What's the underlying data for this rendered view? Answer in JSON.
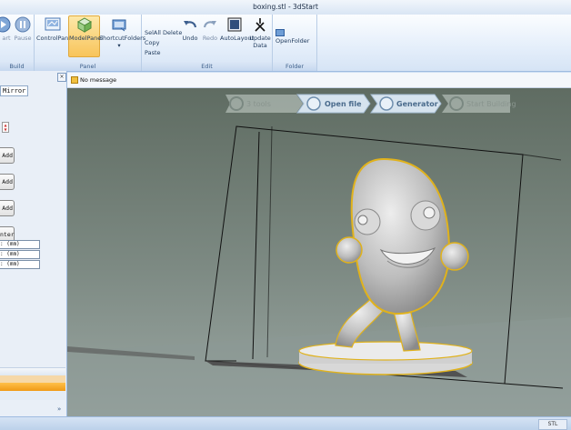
{
  "window": {
    "title": "boxing.stl - 3dStart"
  },
  "ribbon": {
    "build": {
      "label": "Build",
      "start": "art",
      "pause": "Pause"
    },
    "panel": {
      "label": "Panel",
      "control_panel": "ControlPanel",
      "model_panel": "ModelPanel",
      "shortcut_folders": "ShortcutFolders"
    },
    "edit": {
      "label": "Edit",
      "select_all": "SelAll",
      "delete": "Delete",
      "copy": "Copy",
      "paste": "Paste",
      "undo": "Undo",
      "redo": "Redo",
      "autolayout": "AutoLayout",
      "update_data_line1": "Update",
      "update_data_line2": "Data"
    },
    "folder": {
      "label": "Folder",
      "open_folder": "OpenFolder"
    }
  },
  "left_panel": {
    "tab_mirror": "Mirror",
    "close": "×",
    "spinner_up": "▲",
    "spinner_down": "▼",
    "add_1": "Add",
    "add_2": "Add",
    "add_3": "Add",
    "center": "nter",
    "field_1": ": (mm)",
    "field_2": ": (mm)",
    "field_3": ": (mm)",
    "collapse": "»"
  },
  "message": {
    "text": "No message"
  },
  "steps": [
    {
      "label": "3 tools"
    },
    {
      "label": "Open file"
    },
    {
      "label": "Generator"
    },
    {
      "label": "Start Building"
    }
  ],
  "status": {
    "right": "STL"
  }
}
